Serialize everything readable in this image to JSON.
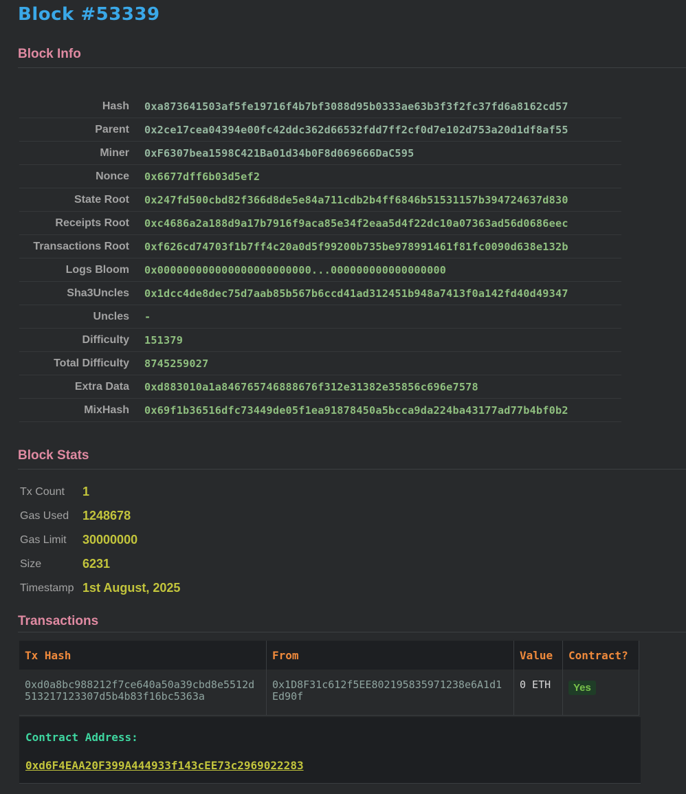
{
  "page": {
    "title": "Block #53339"
  },
  "block_info": {
    "heading": "Block Info",
    "rows": [
      {
        "label": "Hash",
        "value": "0xa873641503af5fe19716f4b7bf3088d95b0333ae63b3f3f2fc37fd6a8162cd57"
      },
      {
        "label": "Parent",
        "value": "0x2ce17cea04394e00fc42ddc362d66532fdd7ff2cf0d7e102d753a20d1df8af55"
      },
      {
        "label": "Miner",
        "value": "0xF6307bea1598C421Ba01d34b0F8d069666DaC595"
      },
      {
        "label": "Nonce",
        "value": "0x6677dff6b03d5ef2"
      },
      {
        "label": "State Root",
        "value": "0x247fd500cbd82f366d8de5e84a711cdb2b4ff6846b51531157b394724637d830"
      },
      {
        "label": "Receipts Root",
        "value": "0xc4686a2a188d9a17b7916f9aca85e34f2eaa5d4f22dc10a07363ad56d0686eec"
      },
      {
        "label": "Transactions Root",
        "value": "0xf626cd74703f1b7ff4c20a0d5f99200b735be978991461f81fc0090d638e132b"
      },
      {
        "label": "Logs Bloom",
        "value": "0x000000000000000000000000...000000000000000000"
      },
      {
        "label": "Sha3Uncles",
        "value": "0x1dcc4de8dec75d7aab85b567b6ccd41ad312451b948a7413f0a142fd40d49347"
      },
      {
        "label": "Uncles",
        "value": "-"
      },
      {
        "label": "Difficulty",
        "value": "151379"
      },
      {
        "label": "Total Difficulty",
        "value": "8745259027"
      },
      {
        "label": "Extra Data",
        "value": "0xd883010a1a846765746888676f312e31382e35856c696e7578"
      },
      {
        "label": "MixHash",
        "value": "0x69f1b36516dfc73449de05f1ea91878450a5bcca9da224ba43177ad77b4bf0b2"
      }
    ]
  },
  "block_stats": {
    "heading": "Block Stats",
    "rows": [
      {
        "label": "Tx Count",
        "value": "1"
      },
      {
        "label": "Gas Used",
        "value": "1248678"
      },
      {
        "label": "Gas Limit",
        "value": "30000000"
      },
      {
        "label": "Size",
        "value": "6231"
      },
      {
        "label": "Timestamp",
        "value": "1st August, 2025"
      }
    ]
  },
  "transactions": {
    "heading": "Transactions",
    "columns": [
      "Tx Hash",
      "From",
      "Value",
      "Contract?"
    ],
    "rows": [
      {
        "tx_hash": "0xd0a8bc988212f7ce640a50a39cbd8e5512d513217123307d5b4b83f16bc5363a",
        "from": "0x1D8F31c612f5EE802195835971238e6A1d1Ed90f",
        "value": "0 ETH",
        "contract": "Yes"
      }
    ],
    "contract_address_label": "Contract Address:",
    "contract_address": "0xd6F4EAA20F399A444933f143cEE73c2969022283"
  },
  "colors": {
    "background": "#282a2c",
    "title": "#3aa8e8",
    "section_heading": "#e08aa2",
    "hash_value": "#8fbf7f",
    "stat_value": "#c3c53c",
    "table_header": "#f08a3c",
    "contract_label": "#3ed6a0",
    "badge_bg": "#1f3d27",
    "badge_text": "#78c24a"
  }
}
